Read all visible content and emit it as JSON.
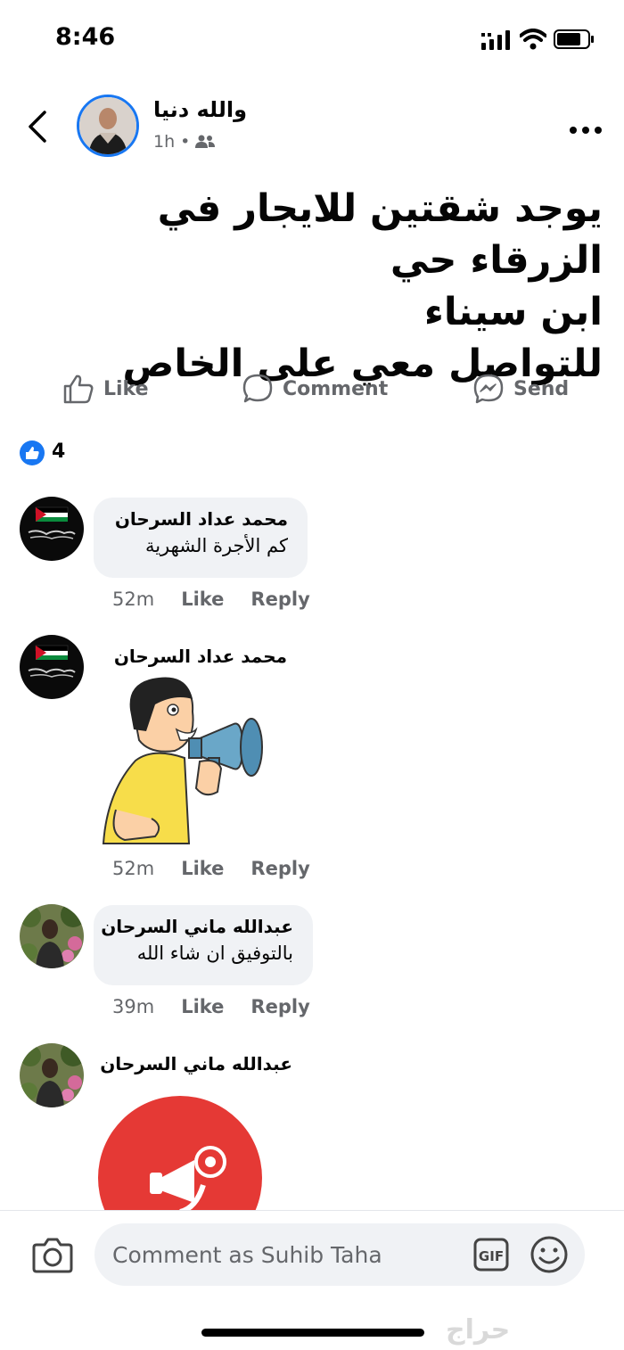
{
  "status_bar": {
    "time": "8:46"
  },
  "post": {
    "author": "والله دنيا",
    "time_ago": "1h",
    "separator": "•",
    "audience_icon": "friends-icon",
    "text_lines": [
      "يوجد شقتين للايجار في الزرقاء حي",
      "ابن سيناء",
      "للتواصل معي على الخاص"
    ]
  },
  "actions": {
    "like": "Like",
    "comment": "Comment",
    "send": "Send"
  },
  "reactions": {
    "count": "4",
    "icon": "like-reaction-icon"
  },
  "comments": [
    {
      "author": "محمد عداد السرحان",
      "text": "كم الأجرة الشهرية",
      "time": "52m",
      "like": "Like",
      "reply": "Reply"
    },
    {
      "author": "محمد عداد السرحان",
      "sticker": "megaphone-boy-sticker",
      "time": "52m",
      "like": "Like",
      "reply": "Reply"
    },
    {
      "author": "عبدالله ماني السرحان",
      "text": "بالتوفيق ان شاء الله",
      "time": "39m",
      "like": "Like",
      "reply": "Reply"
    },
    {
      "author": "عبدالله ماني السرحان",
      "sticker": "red-megaphone-sticker"
    }
  ],
  "composer": {
    "placeholder": "Comment as Suhib Taha",
    "gif_label": "GIF"
  },
  "watermark": "حراج",
  "colors": {
    "accent": "#1877f2",
    "secondary_text": "#65676b",
    "bubble": "#f0f2f5"
  }
}
